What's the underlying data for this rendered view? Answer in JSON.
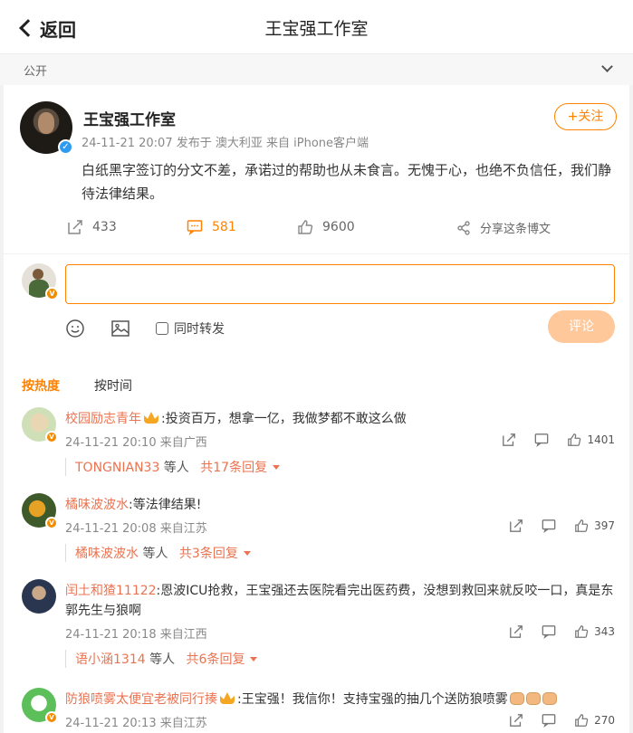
{
  "header": {
    "back_label": "返回",
    "title": "王宝强工作室"
  },
  "visibility": {
    "label": "公开"
  },
  "post": {
    "author": "王宝强工作室",
    "meta": "24-11-21 20:07  发布于 澳大利亚  来自 iPhone客户端",
    "follow_label": "+关注",
    "text": "白纸黑字签订的分文不差，承诺过的帮助也从未食言。无愧于心，也绝不负信任，我们静待法律结果。",
    "repost_count": "433",
    "comment_count": "581",
    "like_count": "9600",
    "share_label": "分享这条博文"
  },
  "composer": {
    "input_value": "",
    "repost_label": "同时转发",
    "submit_label": "评论"
  },
  "sort": {
    "hot_label": "按热度",
    "time_label": "按时间"
  },
  "comments": [
    {
      "name": "校园励志青年",
      "text": ":投资百万，想拿一亿，我做梦都不敢这么做",
      "meta": "24-11-21 20:10 来自广西",
      "likes": "1401",
      "reply_user": "TONGNIAN33",
      "reply_mid": " 等人 ",
      "reply_total": "共17条回复"
    },
    {
      "name": "橘味波波水",
      "text": ":等法律结果!",
      "meta": "24-11-21 20:08 来自江苏",
      "likes": "397",
      "reply_user": "橘味波波水",
      "reply_mid": " 等人 ",
      "reply_total": "共3条回复"
    },
    {
      "name": "闰土和猹11122",
      "text": ":恩波ICU抢救，王宝强还去医院看完出医药费，没想到救回来就反咬一口，真是东郭先生与狼啊",
      "meta": "24-11-21 20:18 来自江西",
      "likes": "343",
      "reply_user": "语小涵1314",
      "reply_mid": " 等人 ",
      "reply_total": "共6条回复"
    },
    {
      "name": "防狼喷雾太便宜老被同行揍",
      "text": ":王宝强！我信你！支持宝强的抽几个送防狼喷雾",
      "meta": "24-11-21 20:13 来自江苏",
      "likes": "270"
    }
  ],
  "colors": {
    "accent": "#ff8200",
    "name": "#eb7350",
    "verified": "#2d9bf0"
  }
}
